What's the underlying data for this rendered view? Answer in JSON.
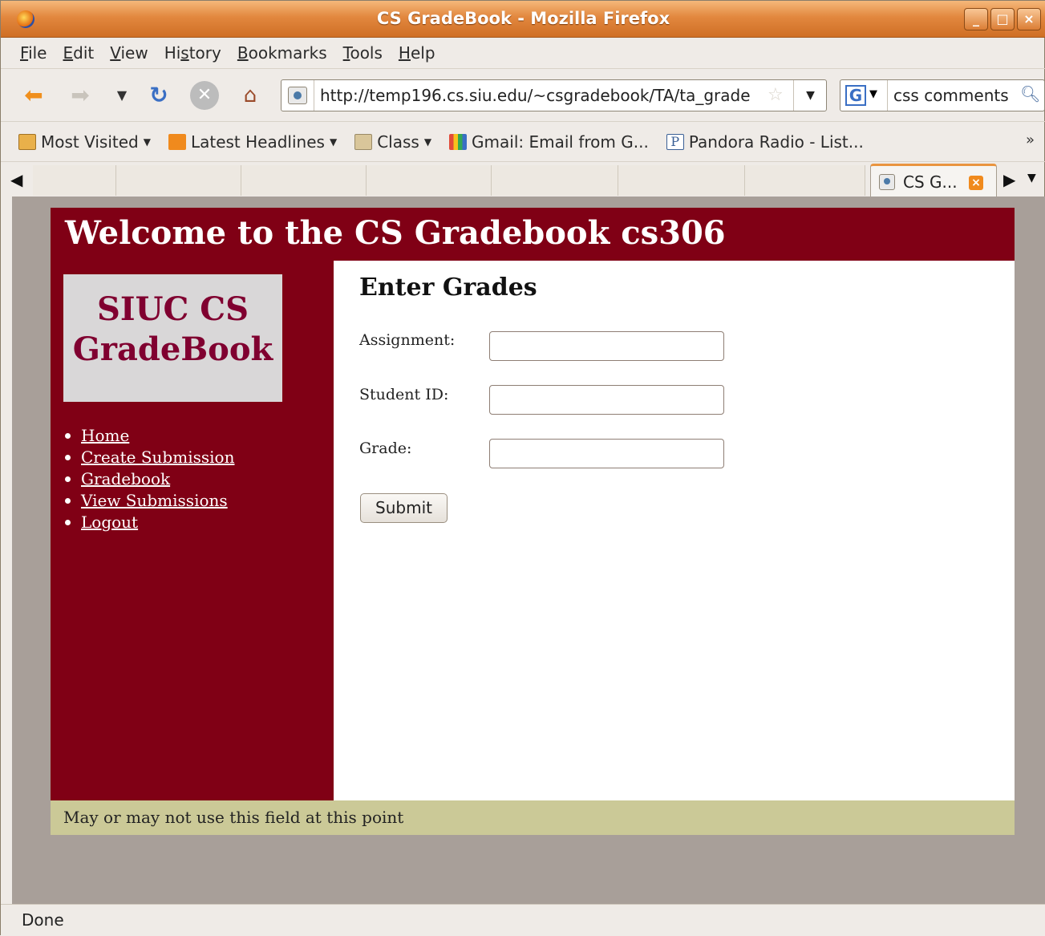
{
  "window": {
    "title": "CS GradeBook - Mozilla Firefox"
  },
  "menu": [
    {
      "pre": "",
      "u": "F",
      "post": "ile"
    },
    {
      "pre": "",
      "u": "E",
      "post": "dit"
    },
    {
      "pre": "",
      "u": "V",
      "post": "iew"
    },
    {
      "pre": "Hi",
      "u": "s",
      "post": "tory"
    },
    {
      "pre": "",
      "u": "B",
      "post": "ookmarks"
    },
    {
      "pre": "",
      "u": "T",
      "post": "ools"
    },
    {
      "pre": "",
      "u": "H",
      "post": "elp"
    }
  ],
  "navigation": {
    "url": "http://temp196.cs.siu.edu/~csgradebook/TA/ta_grade",
    "search_value": "css comments",
    "search_engine_icon": "G"
  },
  "bookmarks": {
    "most_visited": "Most Visited",
    "latest_headlines": "Latest Headlines",
    "class": "Class",
    "gmail": "Gmail: Email from G...",
    "pandora": "Pandora Radio - List...",
    "pandora_icon": "P",
    "overflow": "»"
  },
  "tabs": {
    "active_label": "CS G..."
  },
  "page": {
    "header_title": "Welcome to the CS Gradebook cs306",
    "logo_line1": "SIUC CS",
    "logo_line2": "GradeBook",
    "nav_links": [
      "Home",
      "Create Submission",
      "Gradebook",
      "View Submissions",
      "Logout"
    ],
    "heading": "Enter Grades",
    "fields": {
      "assignment_label": "Assignment:",
      "student_id_label": "Student ID:",
      "grade_label": "Grade:"
    },
    "submit_label": "Submit",
    "footer_text": "May or may not use this field at this point"
  },
  "status": {
    "text": "Done"
  },
  "colors": {
    "brand": "#800015",
    "footer": "#cbc997",
    "content_bg": "#a89f99"
  }
}
